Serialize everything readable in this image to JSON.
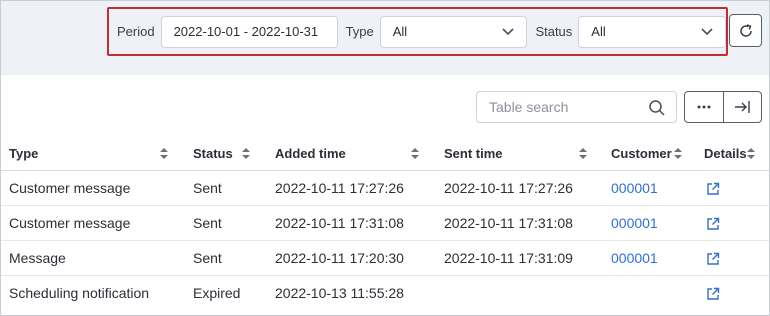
{
  "filters": {
    "period_label": "Period",
    "period_value": "2022-10-01 - 2022-10-31",
    "type_label": "Type",
    "type_value": "All",
    "status_label": "Status",
    "status_value": "All"
  },
  "toolbar": {
    "search_placeholder": "Table search",
    "more_icon": "ellipsis-icon",
    "export_icon": "arrow-right-bar-icon",
    "refresh_icon": "refresh-icon"
  },
  "table": {
    "columns": [
      "Type",
      "Status",
      "Added time",
      "Sent time",
      "Customer",
      "Details"
    ],
    "rows": [
      {
        "type": "Customer message",
        "status": "Sent",
        "added": "2022-10-11 17:27:26",
        "sent": "2022-10-11 17:27:26",
        "customer": "000001"
      },
      {
        "type": "Customer message",
        "status": "Sent",
        "added": "2022-10-11 17:31:08",
        "sent": "2022-10-11 17:31:08",
        "customer": "000001"
      },
      {
        "type": "Message",
        "status": "Sent",
        "added": "2022-10-11 17:20:30",
        "sent": "2022-10-11 17:31:09",
        "customer": "000001"
      },
      {
        "type": "Scheduling notification",
        "status": "Expired",
        "added": "2022-10-13 11:55:28",
        "sent": "",
        "customer": ""
      }
    ]
  },
  "colors": {
    "accent": "#2f6fd6",
    "highlight_border": "#c42b32"
  }
}
